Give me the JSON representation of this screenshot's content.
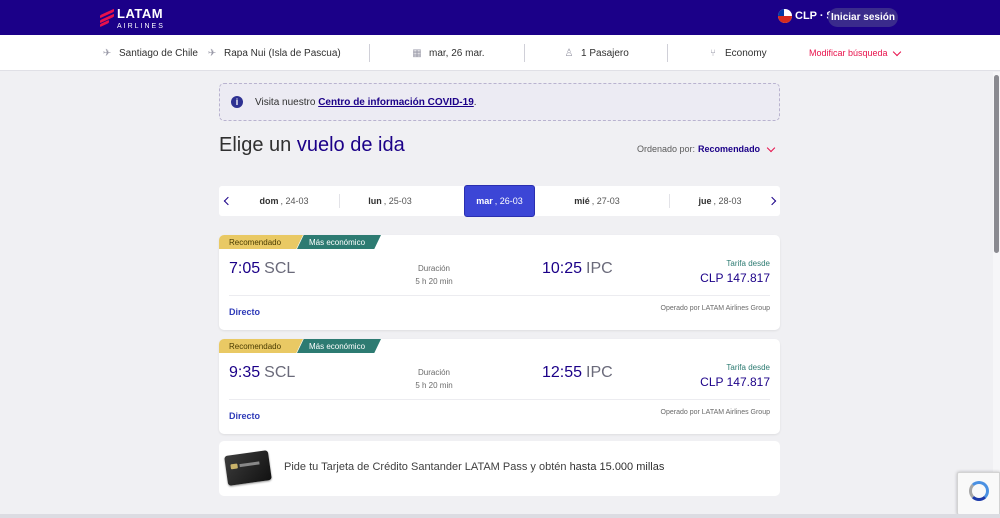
{
  "header": {
    "logo_main": "LATAM",
    "logo_sub": "AIRLINES",
    "currency": "CLP · $",
    "login_label": "Iniciar sesión"
  },
  "search": {
    "origin": "Santiago de Chile",
    "destination": "Rapa Nui (Isla de Pascua)",
    "date": "mar, 26 mar.",
    "passengers": "1 Pasajero",
    "cabin": "Economy",
    "modify_label": "Modificar búsqueda"
  },
  "covid": {
    "prefix": "Visita nuestro ",
    "link": "Centro de información COVID-19",
    "suffix": ".",
    "icon": "info-icon"
  },
  "title": {
    "prefix": "Elige un ",
    "emphasis": "vuelo de ida"
  },
  "sort": {
    "label": "Ordenado por:",
    "value": "Recomendado"
  },
  "dates": [
    {
      "day": "dom",
      "date": ", 24-03"
    },
    {
      "day": "lun",
      "date": ", 25-03"
    },
    {
      "day": "mar",
      "date": ", 26-03"
    },
    {
      "day": "mié",
      "date": ", 27-03"
    },
    {
      "day": "jue",
      "date": ", 28-03"
    }
  ],
  "flights": [
    {
      "tag1": "Recomendado",
      "tag2": "Más económico",
      "dep_time": "7:05",
      "dep_code": "SCL",
      "duration_label": "Duración",
      "duration": "5 h 20 min",
      "arr_time": "10:25",
      "arr_code": "IPC",
      "fare_label": "Tarifa desde",
      "price": "CLP 147.817",
      "stops": "Directo",
      "operator": "Operado por LATAM Airlines Group"
    },
    {
      "tag1": "Recomendado",
      "tag2": "Más económico",
      "dep_time": "9:35",
      "dep_code": "SCL",
      "duration_label": "Duración",
      "duration": "5 h 20 min",
      "arr_time": "12:55",
      "arr_code": "IPC",
      "fare_label": "Tarifa desde",
      "price": "CLP 147.817",
      "stops": "Directo",
      "operator": "Operado por LATAM Airlines Group"
    }
  ],
  "promo": {
    "text": "Pide tu Tarjeta de Crédito Santander LATAM Pass y obtén ",
    "emphasis": "hasta 15.000 millas"
  },
  "colors": {
    "brand_navy": "#1b0088",
    "brand_red": "#e8114b",
    "active_date": "#3c46d6",
    "tag_recommended": "#e9c964",
    "tag_cheapest": "#2d7b72"
  }
}
